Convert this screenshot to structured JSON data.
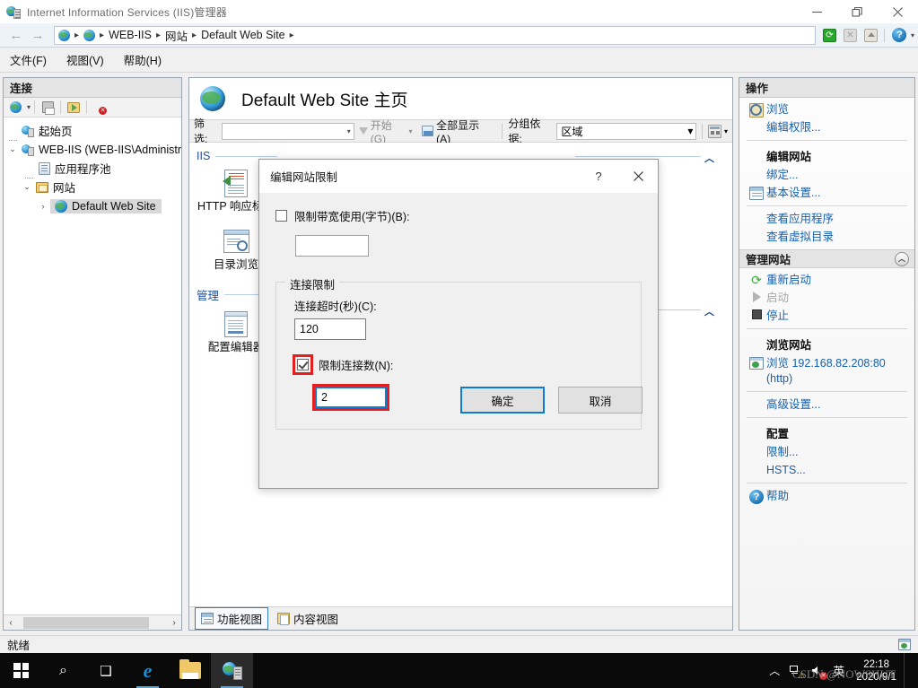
{
  "window": {
    "title": "Internet Information Services (IIS)管理器",
    "icon": "iis-server-icon",
    "minimize_label": "—",
    "restore_label": "❐",
    "close_label": "✕"
  },
  "navbar": {
    "back_label": "←",
    "forward_label": "→",
    "breadcrumbs": [
      {
        "label": "",
        "icon": "globe-icon"
      },
      {
        "label": "",
        "icon": "globe-icon"
      },
      {
        "label": "WEB-IIS",
        "icon": ""
      },
      {
        "label": "网站",
        "icon": ""
      },
      {
        "label": "Default Web Site",
        "icon": ""
      }
    ],
    "separator": "▸",
    "refresh_label": "⟳",
    "stop_label": "✕",
    "home_label": "",
    "help_label": "?",
    "help_caret": "▾"
  },
  "menubar": {
    "items": [
      {
        "label": "文件(F)"
      },
      {
        "label": "视图(V)"
      },
      {
        "label": "帮助(H)"
      }
    ]
  },
  "connections": {
    "header": "连接",
    "toolbar": [
      {
        "name": "connect-to-icon",
        "caret": "▾"
      },
      {
        "name": "save-connections-icon"
      },
      {
        "name": "open-site-icon"
      },
      {
        "name": "disconnect-icon"
      }
    ],
    "tree": [
      {
        "label": "起始页",
        "icon": "start-page-icon",
        "twist": "",
        "depth": 0,
        "selected": false
      },
      {
        "label": "WEB-IIS (WEB-IIS\\Administr",
        "icon": "server-icon",
        "twist": "⌄",
        "depth": 0,
        "selected": false
      },
      {
        "label": "应用程序池",
        "icon": "app-pools-icon",
        "twist": "",
        "depth": 1,
        "selected": false
      },
      {
        "label": "网站",
        "icon": "sites-folder-icon",
        "twist": "⌄",
        "depth": 1,
        "selected": false
      },
      {
        "label": "Default Web Site",
        "icon": "site-globe-icon",
        "twist": "›",
        "depth": 2,
        "selected": true
      }
    ],
    "hscroll_left": "‹",
    "hscroll_right": "›"
  },
  "content": {
    "page_title": "Default Web Site 主页",
    "page_icon": "site-globe-icon",
    "filter": {
      "label": "筛选:",
      "value": "",
      "placeholder": "",
      "dropdown_caret": "▾",
      "go_label": "开始(G)",
      "go_caret": "▾",
      "show_all_label": "全部显示(A)",
      "group_by_label": "分组依据:",
      "group_by_value": "区域",
      "group_caret": "▾",
      "view_caret": "▾"
    },
    "groups": [
      {
        "name": "IIS",
        "features": [
          {
            "label": "HTTP 响应标头",
            "icon": "http-response-headers-icon"
          },
          {
            "label": "目录浏览",
            "icon": "directory-browsing-icon"
          }
        ]
      },
      {
        "name": "管理",
        "features": [
          {
            "label": "配置编辑器",
            "icon": "configuration-editor-icon"
          }
        ]
      }
    ],
    "collapse_chevron": "︿",
    "view_tabs": [
      {
        "label": "功能视图",
        "icon": "features-view-icon",
        "active": true
      },
      {
        "label": "内容视图",
        "icon": "content-view-icon",
        "active": false
      }
    ]
  },
  "actions": {
    "header": "操作",
    "items": [
      {
        "label": "浏览",
        "icon": "browse-icon",
        "type": "link"
      },
      {
        "label": "编辑权限...",
        "icon": "",
        "type": "link"
      },
      {
        "type": "separator"
      },
      {
        "label": "编辑网站",
        "type": "group-title"
      },
      {
        "label": "绑定...",
        "icon": "",
        "type": "link"
      },
      {
        "label": "基本设置...",
        "icon": "basic-settings-icon",
        "type": "link"
      },
      {
        "type": "separator"
      },
      {
        "label": "查看应用程序",
        "icon": "",
        "type": "link"
      },
      {
        "label": "查看虚拟目录",
        "icon": "",
        "type": "link"
      },
      {
        "label": "管理网站",
        "type": "section",
        "collapse": "︿"
      },
      {
        "label": "重新启动",
        "icon": "restart-icon",
        "type": "link"
      },
      {
        "label": "启动",
        "icon": "start-icon",
        "type": "link-disabled"
      },
      {
        "label": "停止",
        "icon": "stop-icon",
        "type": "link"
      },
      {
        "type": "separator"
      },
      {
        "label": "浏览网站",
        "type": "group-title"
      },
      {
        "label": "浏览 192.168.82.208:80 (http)",
        "icon": "browse-site-icon",
        "type": "link"
      },
      {
        "type": "separator"
      },
      {
        "label": "高级设置...",
        "icon": "",
        "type": "link"
      },
      {
        "type": "separator"
      },
      {
        "label": "配置",
        "type": "group-title"
      },
      {
        "label": "限制...",
        "icon": "",
        "type": "link"
      },
      {
        "label": "HSTS...",
        "icon": "",
        "type": "link"
      },
      {
        "type": "separator"
      },
      {
        "label": "帮助",
        "icon": "help-icon",
        "type": "link"
      }
    ]
  },
  "dialog": {
    "title": "编辑网站限制",
    "help_label": "?",
    "close_label": "✕",
    "bandwidth": {
      "checkbox_label": "限制带宽使用(字节)(B):",
      "checked": false,
      "value": ""
    },
    "connection_group": {
      "legend": "连接限制",
      "timeout_label": "连接超时(秒)(C):",
      "timeout_value": "120",
      "limit_checkbox_label": "限制连接数(N):",
      "limit_checked": true,
      "limit_value": "2"
    },
    "ok_label": "确定",
    "cancel_label": "取消",
    "highlight_color": "#e41f1f",
    "focus_color": "#0c7cd5"
  },
  "statusbar": {
    "text": "就绪",
    "icon": "site-status-icon"
  },
  "taskbar": {
    "start_label": "",
    "search_label": "⌕",
    "taskview_label": "❑",
    "apps": [
      {
        "name": "internet-explorer",
        "label": "e"
      },
      {
        "name": "file-explorer",
        "label": ""
      },
      {
        "name": "iis-manager",
        "label": ""
      }
    ],
    "tray": {
      "chevron": "︿",
      "network_label": "",
      "volume_label": "",
      "ime_label": "英"
    },
    "clock_time": "22:18",
    "clock_date": "2020/9/1"
  },
  "watermark": "CSDN @NOWSHUT"
}
